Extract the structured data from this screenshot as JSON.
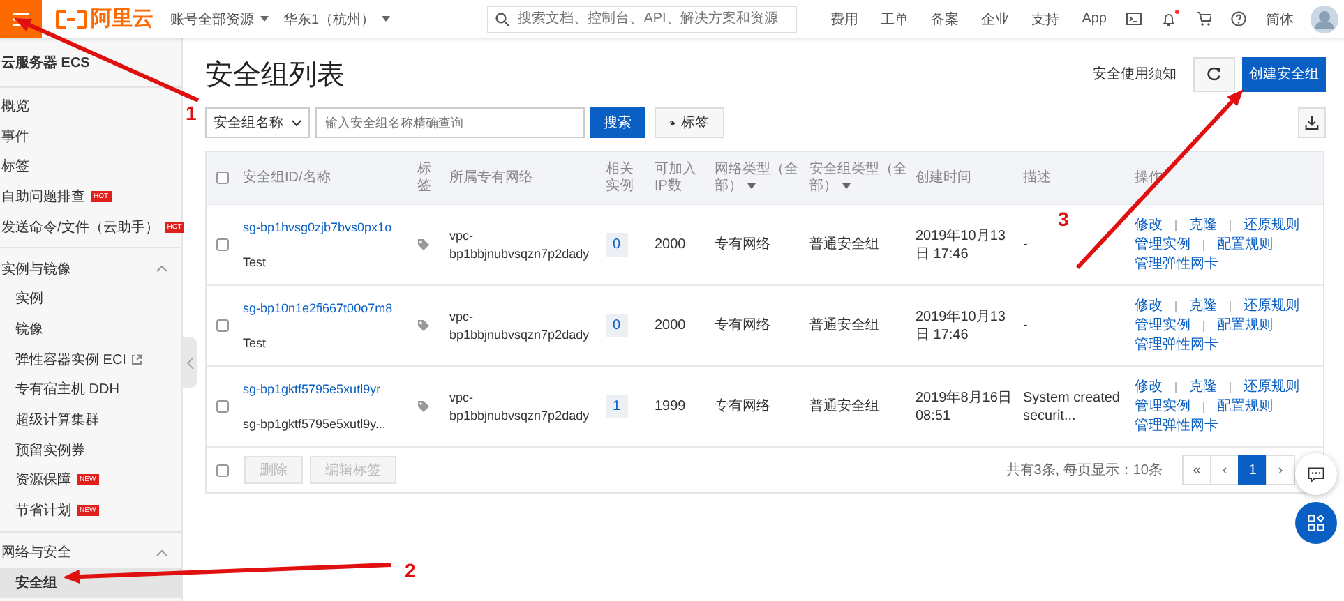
{
  "topbar": {
    "logo_text": "阿里云",
    "account_scope": "账号全部资源",
    "region": "华东1（杭州）",
    "search_placeholder": "搜索文档、控制台、API、解决方案和资源",
    "nav": [
      "费用",
      "工单",
      "备案",
      "企业",
      "支持",
      "App"
    ],
    "notifications_unread": true,
    "language": "简体"
  },
  "sidebar": {
    "title": "云服务器 ECS",
    "items": [
      {
        "kind": "item",
        "label": "概览",
        "selected": false
      },
      {
        "kind": "item",
        "label": "事件",
        "selected": false
      },
      {
        "kind": "item",
        "label": "标签",
        "selected": false
      },
      {
        "kind": "item",
        "label": "自助问题排查",
        "badge": "HOT",
        "selected": false
      },
      {
        "kind": "item",
        "label": "发送命令/文件（云助手）",
        "badge": "HOT",
        "selected": false
      },
      {
        "kind": "section",
        "label": "实例与镜像",
        "expanded": true,
        "children": [
          {
            "kind": "item",
            "label": "实例",
            "selected": false
          },
          {
            "kind": "item",
            "label": "镜像",
            "selected": false
          },
          {
            "kind": "item",
            "label": "弹性容器实例 ECI",
            "external": true,
            "selected": false
          },
          {
            "kind": "item",
            "label": "专有宿主机 DDH",
            "selected": false
          },
          {
            "kind": "item",
            "label": "超级计算集群",
            "selected": false
          },
          {
            "kind": "item",
            "label": "预留实例券",
            "selected": false
          },
          {
            "kind": "item",
            "label": "资源保障",
            "badge": "NEW",
            "selected": false
          },
          {
            "kind": "item",
            "label": "节省计划",
            "badge": "NEW",
            "selected": false
          }
        ]
      },
      {
        "kind": "section",
        "label": "网络与安全",
        "expanded": true,
        "children": [
          {
            "kind": "item",
            "label": "安全组",
            "selected": true
          }
        ]
      }
    ]
  },
  "page": {
    "title": "安全组列表",
    "notice_link": "安全使用须知",
    "create_button": "创建安全组",
    "filter_select": "安全组名称",
    "search_placeholder": "输入安全组名称精确查询",
    "search_button": "搜索",
    "tag_button": "标签"
  },
  "table": {
    "columns": [
      {
        "label": "安全组ID/名称",
        "filter": false
      },
      {
        "label": "标签",
        "filter": false
      },
      {
        "label": "所属专有网络",
        "filter": false
      },
      {
        "label": "相关实例",
        "filter": false
      },
      {
        "label": "可加入IP数",
        "filter": false
      },
      {
        "label": "网络类型（全部）",
        "filter": true
      },
      {
        "label": "安全组类型（全部）",
        "filter": true
      },
      {
        "label": "创建时间",
        "filter": false
      },
      {
        "label": "描述",
        "filter": false
      },
      {
        "label": "操作",
        "filter": false
      }
    ],
    "select_all_checked": false,
    "rows": [
      {
        "checked": false,
        "id": "sg-bp1hvsg0zjb7bvs0px1o",
        "name": "Test",
        "vpc": "vpc-bp1bbjnubvsqzn7p2dady",
        "instances": "0",
        "ip_count": "2000",
        "network_type": "专有网络",
        "group_type": "普通安全组",
        "created": "2019年10月13日 17:46",
        "description": "-",
        "actions": [
          [
            "修改",
            "克隆",
            "还原规则"
          ],
          [
            "管理实例",
            "配置规则"
          ],
          [
            "管理弹性网卡"
          ]
        ]
      },
      {
        "checked": false,
        "id": "sg-bp10n1e2fi667t00o7m8",
        "name": "Test",
        "vpc": "vpc-bp1bbjnubvsqzn7p2dady",
        "instances": "0",
        "ip_count": "2000",
        "network_type": "专有网络",
        "group_type": "普通安全组",
        "created": "2019年10月13日 17:46",
        "description": "-",
        "actions": [
          [
            "修改",
            "克隆",
            "还原规则"
          ],
          [
            "管理实例",
            "配置规则"
          ],
          [
            "管理弹性网卡"
          ]
        ]
      },
      {
        "checked": false,
        "id": "sg-bp1gktf5795e5xutl9yr",
        "name": "sg-bp1gktf5795e5xutl9y...",
        "vpc": "vpc-bp1bbjnubvsqzn7p2dady",
        "instances": "1",
        "ip_count": "1999",
        "network_type": "专有网络",
        "group_type": "普通安全组",
        "created": "2019年8月16日 08:51",
        "description": "System created securit...",
        "actions": [
          [
            "修改",
            "克隆",
            "还原规则"
          ],
          [
            "管理实例",
            "配置规则"
          ],
          [
            "管理弹性网卡"
          ]
        ]
      }
    ],
    "footer": {
      "checked": false,
      "batch_buttons": [
        {
          "label": "删除",
          "disabled": true
        },
        {
          "label": "编辑标签",
          "disabled": true
        }
      ],
      "summary": "共有3条, 每页显示：10条",
      "pages": [
        {
          "label": "«",
          "selected": false
        },
        {
          "label": "‹",
          "selected": false
        },
        {
          "label": "1",
          "selected": true
        },
        {
          "label": "›",
          "selected": false
        }
      ]
    }
  },
  "annotations": [
    {
      "label": "1"
    },
    {
      "label": "2"
    },
    {
      "label": "3"
    }
  ]
}
